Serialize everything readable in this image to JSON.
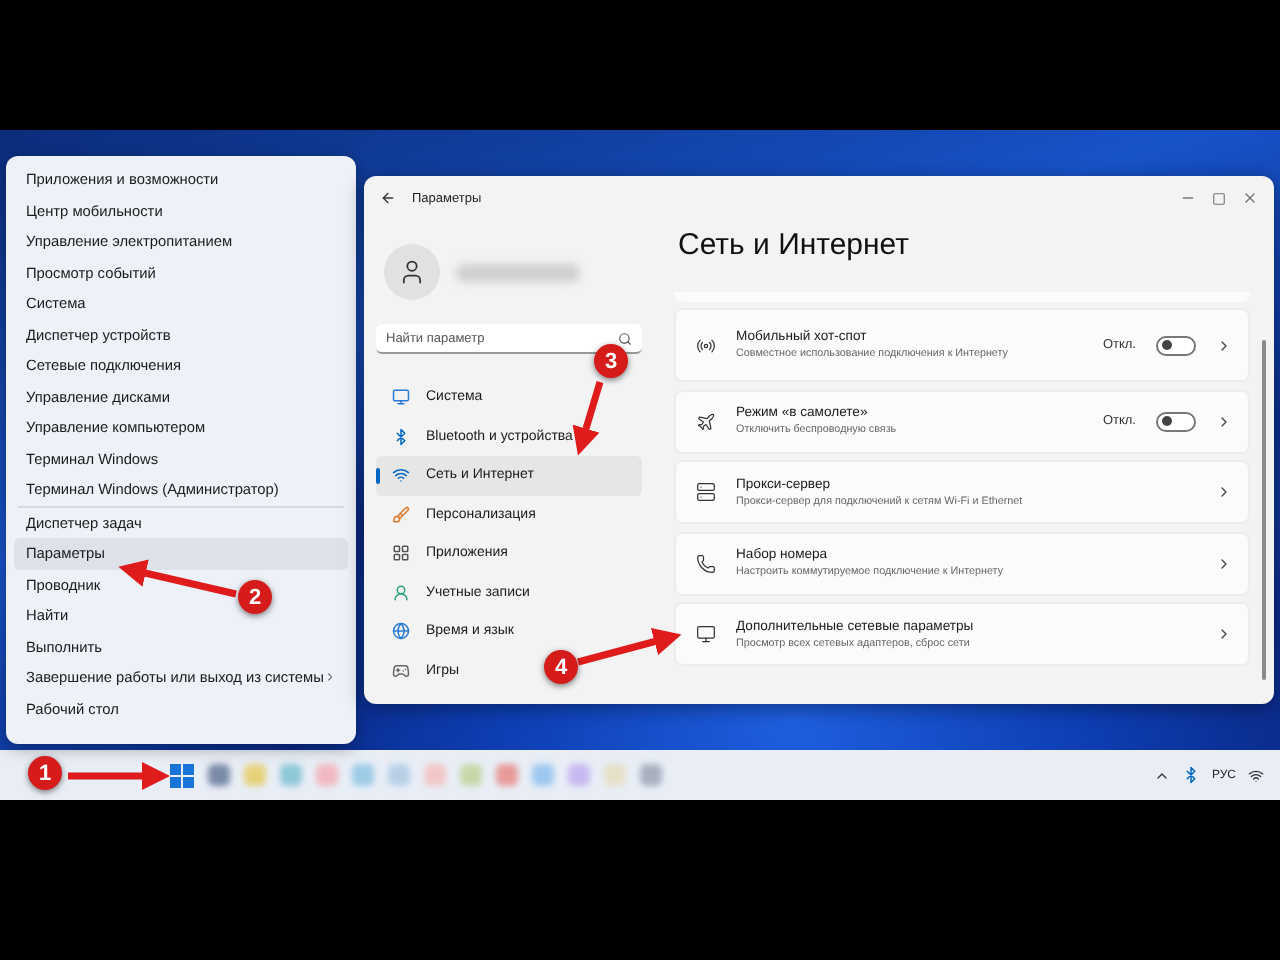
{
  "context_menu": {
    "items": [
      {
        "label": "Приложения и возможности",
        "highlighted": false,
        "submenu": false,
        "separator_before": false
      },
      {
        "label": "Центр мобильности",
        "highlighted": false,
        "submenu": false,
        "separator_before": false
      },
      {
        "label": "Управление электропитанием",
        "highlighted": false,
        "submenu": false,
        "separator_before": false
      },
      {
        "label": "Просмотр событий",
        "highlighted": false,
        "submenu": false,
        "separator_before": false
      },
      {
        "label": "Система",
        "highlighted": false,
        "submenu": false,
        "separator_before": false
      },
      {
        "label": "Диспетчер устройств",
        "highlighted": false,
        "submenu": false,
        "separator_before": false
      },
      {
        "label": "Сетевые подключения",
        "highlighted": false,
        "submenu": false,
        "separator_before": false
      },
      {
        "label": "Управление дисками",
        "highlighted": false,
        "submenu": false,
        "separator_before": false
      },
      {
        "label": "Управление компьютером",
        "highlighted": false,
        "submenu": false,
        "separator_before": false
      },
      {
        "label": "Терминал Windows",
        "highlighted": false,
        "submenu": false,
        "separator_before": false
      },
      {
        "label": "Терминал Windows (Администратор)",
        "highlighted": false,
        "submenu": false,
        "separator_before": false
      },
      {
        "label": "Диспетчер задач",
        "highlighted": false,
        "submenu": false,
        "separator_before": true
      },
      {
        "label": "Параметры",
        "highlighted": true,
        "submenu": false,
        "separator_before": false
      },
      {
        "label": "Проводник",
        "highlighted": false,
        "submenu": false,
        "separator_before": false
      },
      {
        "label": "Найти",
        "highlighted": false,
        "submenu": false,
        "separator_before": false
      },
      {
        "label": "Выполнить",
        "highlighted": false,
        "submenu": false,
        "separator_before": false
      },
      {
        "label": "Завершение работы или выход из системы",
        "highlighted": false,
        "submenu": true,
        "separator_before": false
      },
      {
        "label": "Рабочий стол",
        "highlighted": false,
        "submenu": false,
        "separator_before": false
      }
    ]
  },
  "settings_window": {
    "title": "Параметры",
    "search": {
      "placeholder": "Найти параметр"
    },
    "nav_items": [
      {
        "label": "Система",
        "selected": false
      },
      {
        "label": "Bluetooth и устройства",
        "selected": false
      },
      {
        "label": "Сеть и Интернет",
        "selected": true
      },
      {
        "label": "Персонализация",
        "selected": false
      },
      {
        "label": "Приложения",
        "selected": false
      },
      {
        "label": "Учетные записи",
        "selected": false
      },
      {
        "label": "Время и язык",
        "selected": false
      },
      {
        "label": "Игры",
        "selected": false
      }
    ],
    "heading": "Сеть и Интернет",
    "cards": [
      {
        "kind": "toggle",
        "title": "Мобильный хот-спот",
        "subtitle": "Совместное использование подключения к Интернету",
        "status": "Откл.",
        "on": false
      },
      {
        "kind": "toggle",
        "title": "Режим «в самолете»",
        "subtitle": "Отключить беспроводную связь",
        "status": "Откл.",
        "on": false
      },
      {
        "kind": "link",
        "title": "Прокси-сервер",
        "subtitle": "Прокси-сервер для подключений к сетям Wi-Fi и Ethernet"
      },
      {
        "kind": "link",
        "title": "Набор номера",
        "subtitle": "Настроить коммутируемое подключение к Интернету"
      },
      {
        "kind": "link",
        "title": "Дополнительные сетевые параметры",
        "subtitle": "Просмотр всех сетевых адаптеров, сброс сети"
      }
    ]
  },
  "taskbar": {
    "language": "РУС"
  },
  "annotations": [
    {
      "number": "1"
    },
    {
      "number": "2"
    },
    {
      "number": "3"
    },
    {
      "number": "4"
    }
  ]
}
